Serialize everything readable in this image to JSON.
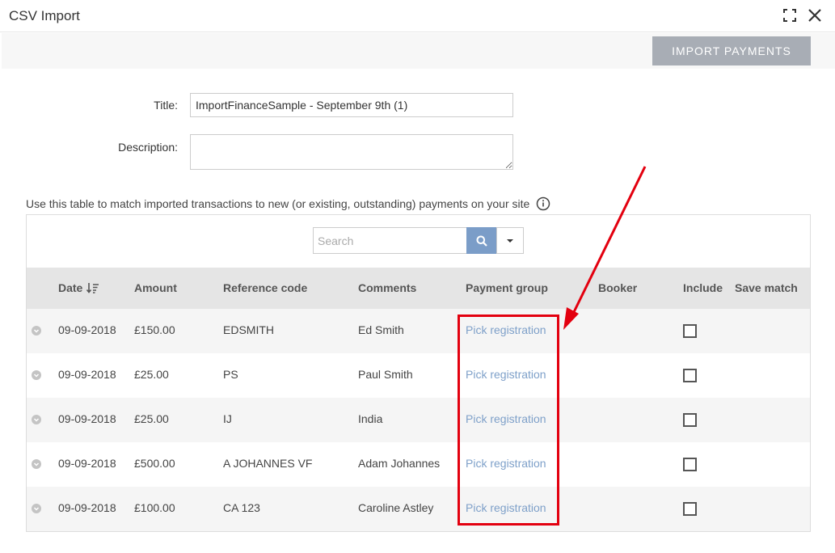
{
  "dialog": {
    "title": "CSV Import",
    "expand_icon": "expand-icon",
    "close_icon": "close-icon"
  },
  "toolbar": {
    "import_label": "IMPORT PAYMENTS"
  },
  "form": {
    "title_label": "Title:",
    "title_value": "ImportFinanceSample - September 9th (1)",
    "description_label": "Description:",
    "description_value": ""
  },
  "helper_text": "Use this table to match imported transactions to new (or existing, outstanding) payments on your site",
  "search": {
    "placeholder": "Search",
    "value": ""
  },
  "table": {
    "columns": [
      "Date",
      "Amount",
      "Reference code",
      "Comments",
      "Payment group",
      "Booker",
      "Include",
      "Save match"
    ],
    "rows": [
      {
        "date": "09-09-2018",
        "amount": "£150.00",
        "reference": "EDSMITH",
        "comments": "Ed Smith",
        "payment_group": "Pick registration",
        "booker": "",
        "include": false
      },
      {
        "date": "09-09-2018",
        "amount": "£25.00",
        "reference": "PS",
        "comments": "Paul Smith",
        "payment_group": "Pick registration",
        "booker": "",
        "include": false
      },
      {
        "date": "09-09-2018",
        "amount": "£25.00",
        "reference": "IJ",
        "comments": "India",
        "payment_group": "Pick registration",
        "booker": "",
        "include": false
      },
      {
        "date": "09-09-2018",
        "amount": "£500.00",
        "reference": "A JOHANNES VF",
        "comments": "Adam Johannes",
        "payment_group": "Pick registration",
        "booker": "",
        "include": false
      },
      {
        "date": "09-09-2018",
        "amount": "£100.00",
        "reference": "CA 123",
        "comments": "Caroline Astley",
        "payment_group": "Pick registration",
        "booker": "",
        "include": false
      }
    ]
  },
  "colors": {
    "accent": "#7b9dc8",
    "link": "#7ea0c9",
    "annotation": "#e3000f",
    "button_disabled": "#a8adb5"
  }
}
